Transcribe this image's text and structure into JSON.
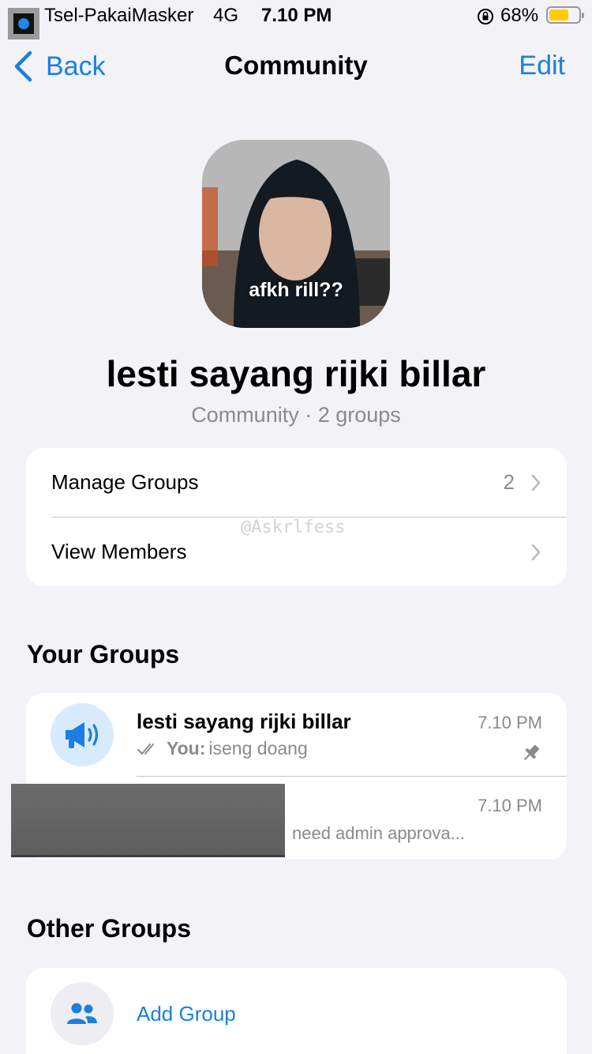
{
  "status_bar": {
    "carrier": "Tsel-PakaiMasker",
    "network": "4G",
    "time": "7.10 PM",
    "battery_percent": "68%",
    "battery_level": 0.68,
    "battery_color": "#ffcc00",
    "icons": [
      "app-icon",
      "orientation-lock-icon",
      "battery-icon"
    ]
  },
  "nav": {
    "back_label": "Back",
    "title": "Community",
    "edit_label": "Edit",
    "accent_color": "#1a7fe0"
  },
  "community": {
    "avatar_caption": "afkh rill??",
    "name": "lesti sayang rijki billar",
    "subtitle": "Community · 2 groups"
  },
  "actions": [
    {
      "label": "Manage Groups",
      "count": "2",
      "icon": "chevron-right-icon"
    },
    {
      "label": "View Members",
      "count": "",
      "icon": "chevron-right-icon"
    }
  ],
  "watermark": "@Askrlfess",
  "your_groups": {
    "title": "Your Groups",
    "items": [
      {
        "name": "lesti sayang rijki billar",
        "time": "7.10 PM",
        "sender": "You:",
        "message": "iseng doang",
        "pinned": true,
        "icon": "megaphone-icon"
      },
      {
        "name": "",
        "time": "7.10 PM",
        "message": "need admin approva...",
        "redacted": true
      }
    ]
  },
  "other_groups": {
    "title": "Other Groups",
    "add_label": "Add Group",
    "icon": "people-icon"
  }
}
